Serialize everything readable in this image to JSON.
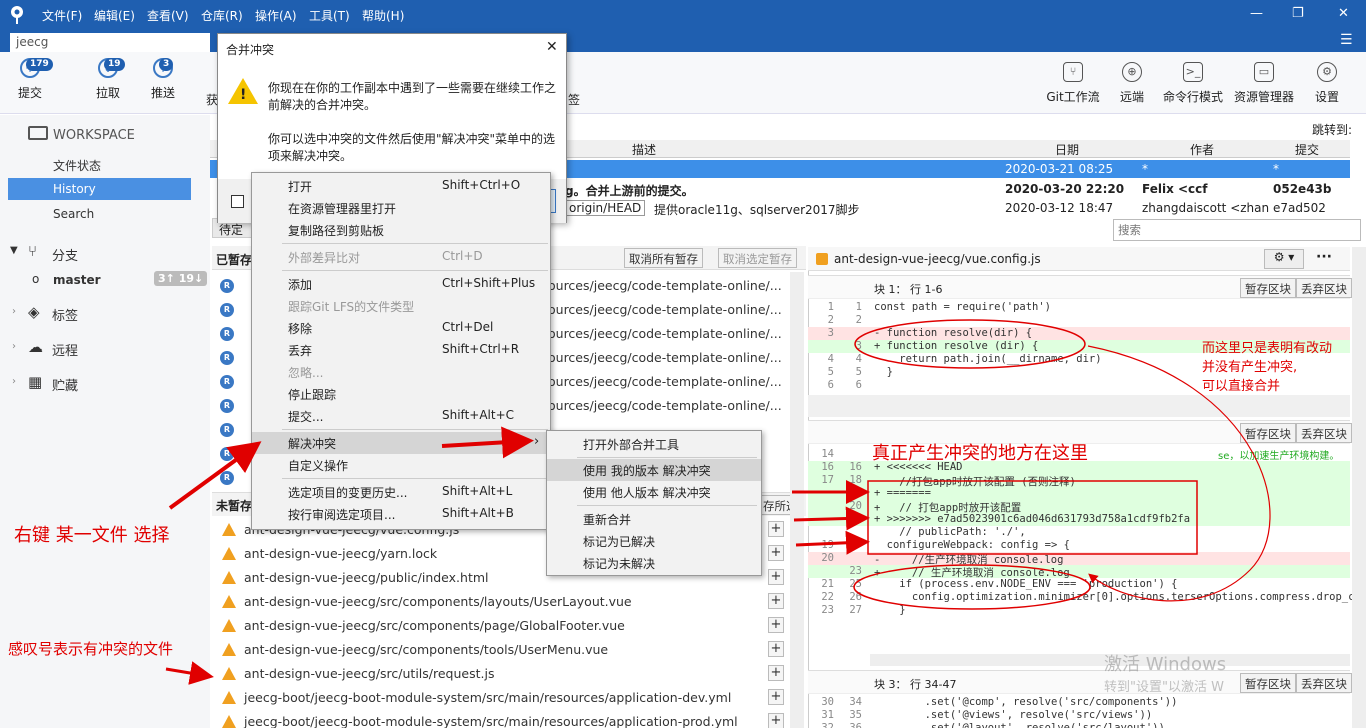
{
  "menubar": {
    "items": [
      "文件(F)",
      "编辑(E)",
      "查看(V)",
      "仓库(R)",
      "操作(A)",
      "工具(T)",
      "帮助(H)"
    ]
  },
  "tab": {
    "title": "jeecg"
  },
  "toolbar": {
    "commit": {
      "label": "提交",
      "badge": "179"
    },
    "pull": {
      "label": "拉取",
      "badge": "19"
    },
    "push": {
      "label": "推送",
      "badge": "3"
    },
    "fetch_partial": "获",
    "tag_partial": "签",
    "gitflow": "Git工作流",
    "remote": "远端",
    "terminal": "命令行模式",
    "explorer": "资源管理器",
    "settings": "设置"
  },
  "sidebar": {
    "workspace": "WORKSPACE",
    "file_status": "文件状态",
    "history": "History",
    "search": "Search",
    "branches": "分支",
    "master": "master",
    "master_badge": "3↑ 19↓",
    "tags": "标签",
    "remotes": "远程",
    "stashes": "贮藏"
  },
  "history": {
    "jump_to": "跳转到:",
    "columns": [
      "描述",
      "日期",
      "作者",
      "提交"
    ],
    "rows": [
      {
        "desc": "",
        "date": "2020-03-21 08:25",
        "author": "*",
        "commit": "*"
      },
      {
        "desc": "g。合并上游前的提交。",
        "date": "2020-03-20 22:20",
        "author": "Felix <ccf",
        "commit": "052e43b"
      },
      {
        "desc": "提供oracle11g、sqlserver2017脚步",
        "branch_tag": "origin/HEAD",
        "date": "2020-03-12 18:47",
        "author": "zhangdaiscott <zhan",
        "commit": "e7ad502"
      }
    ],
    "search_placeholder": "搜索"
  },
  "staged": {
    "title_partial": "已暂存",
    "pending_partial": "待定",
    "unstage_all": "取消所有暂存",
    "unstage_selected": "取消选定暂存",
    "files_suffix": "ources/jeecg/code-template-online/..."
  },
  "unstaged": {
    "title_partial": "未暂存",
    "stage_selected_partial": "存所选",
    "files": [
      "ant-design-vue-jeecg/vue.config.js",
      "ant-design-vue-jeecg/yarn.lock",
      "ant-design-vue-jeecg/public/index.html",
      "ant-design-vue-jeecg/src/components/layouts/UserLayout.vue",
      "ant-design-vue-jeecg/src/components/page/GlobalFooter.vue",
      "ant-design-vue-jeecg/src/components/tools/UserMenu.vue",
      "ant-design-vue-jeecg/src/utils/request.js",
      "jeecg-boot/jeecg-boot-module-system/src/main/resources/application-dev.yml",
      "jeecg-boot/jeecg-boot-module-system/src/main/resources/application-prod.yml"
    ]
  },
  "diff": {
    "file": "ant-design-vue-jeecg/vue.config.js",
    "stage_hunk": "暂存区块",
    "discard_hunk": "丢弃区块",
    "hunk1_title": "块 1： 行 1-6",
    "hunk3_title": "块 3： 行 34-47",
    "hunk1_lines": [
      {
        "o": "1",
        "n": "1",
        "t": "const path = require('path')",
        "k": ""
      },
      {
        "o": "2",
        "n": "2",
        "t": "",
        "k": ""
      },
      {
        "o": "3",
        "n": "",
        "t": "- function resolve(dir) {",
        "k": "del"
      },
      {
        "o": "",
        "n": "3",
        "t": "+ function resolve (dir) {",
        "k": "add"
      },
      {
        "o": "4",
        "n": "4",
        "t": "    return path.join(__dirname, dir)",
        "k": ""
      },
      {
        "o": "5",
        "n": "5",
        "t": "  }",
        "k": ""
      },
      {
        "o": "6",
        "n": "6",
        "t": "",
        "k": ""
      }
    ],
    "hunk2_lines": [
      {
        "o": "14",
        "n": "",
        "t": "",
        "k": ""
      },
      {
        "o": "16",
        "n": "16",
        "t": "+ <<<<<<< HEAD",
        "k": "add"
      },
      {
        "o": "17",
        "n": "18",
        "t": "    //打包app时放开该配置 (否则注释)",
        "k": "add"
      },
      {
        "o": "",
        "n": "19",
        "t": "+ =======",
        "k": "add"
      },
      {
        "o": "",
        "n": "20",
        "t": "+   // 打包app时放开该配置",
        "k": "add"
      },
      {
        "o": "",
        "n": "21",
        "t": "+ >>>>>>> e7ad5023901c6ad046d631793d758a1cdf9fb2fa",
        "k": "add"
      },
      {
        "o": "",
        "n": "",
        "t": "    // publicPath: './',",
        "k": ""
      },
      {
        "o": "19",
        "n": "",
        "t": "  configureWebpack: config => {",
        "k": ""
      },
      {
        "o": "20",
        "n": "",
        "t": "-     //生产环境取消 console.log",
        "k": "del"
      },
      {
        "o": "",
        "n": "23",
        "t": "+     // 生产环境取消 console.log",
        "k": "add"
      },
      {
        "o": "21",
        "n": "25",
        "t": "    if (process.env.NODE_ENV === 'production') {",
        "k": ""
      },
      {
        "o": "22",
        "n": "26",
        "t": "      config.optimization.minimizer[0].options.terserOptions.compress.drop_c",
        "k": ""
      },
      {
        "o": "23",
        "n": "27",
        "t": "    }",
        "k": ""
      }
    ],
    "hunk2_trailing": "se，以加速生产环境构建。",
    "hunk3_lines": [
      {
        "o": "30",
        "n": "34",
        "t": "        .set('@comp', resolve('src/components'))",
        "k": ""
      },
      {
        "o": "31",
        "n": "35",
        "t": "        .set('@views', resolve('src/views'))",
        "k": ""
      },
      {
        "o": "32",
        "n": "36",
        "t": "        .set('@layout', resolve('src/layout'))",
        "k": ""
      }
    ]
  },
  "dialog": {
    "title": "合并冲突",
    "line1": "你现在在你的工作副本中遇到了一些需要在继续工作之前解决的合并冲突。",
    "line2": "你可以选中冲突的文件然后使用\"解决冲突\"菜单中的选项来解决冲突。"
  },
  "context_menu": [
    {
      "label": "打开",
      "key": "Shift+Ctrl+O",
      "dis": false
    },
    {
      "label": "在资源管理器里打开",
      "key": "",
      "dis": false
    },
    {
      "label": "复制路径到剪贴板",
      "key": "",
      "dis": false
    },
    {
      "label": "外部差异比对",
      "key": "Ctrl+D",
      "dis": true
    },
    {
      "label": "添加",
      "key": "Ctrl+Shift+Plus",
      "dis": false
    },
    {
      "label": "跟踪Git LFS的文件类型",
      "key": "",
      "dis": true
    },
    {
      "label": "移除",
      "key": "Ctrl+Del",
      "dis": false
    },
    {
      "label": "丢弃",
      "key": "Shift+Ctrl+R",
      "dis": false
    },
    {
      "label": "忽略...",
      "key": "",
      "dis": true
    },
    {
      "label": "停止跟踪",
      "key": "",
      "dis": false
    },
    {
      "label": "提交...",
      "key": "Shift+Alt+C",
      "dis": false
    },
    {
      "label": "解决冲突",
      "key": "",
      "dis": false
    },
    {
      "label": "自定义操作",
      "key": "",
      "dis": false
    },
    {
      "label": "选定项目的变更历史...",
      "key": "Shift+Alt+L",
      "dis": false
    },
    {
      "label": "按行审阅选定项目...",
      "key": "Shift+Alt+B",
      "dis": false
    }
  ],
  "submenu": [
    "打开外部合并工具",
    "使用 我的版本 解决冲突",
    "使用 他人版本 解决冲突",
    "重新合并",
    "标记为已解决",
    "标记为未解决"
  ],
  "annotations": {
    "right_click": "右键 某一文件 选择",
    "warning_meaning": "感叹号表示有冲突的文件",
    "real_conflict": "真正产生冲突的地方在这里",
    "note1": "而这里只是表明有改动",
    "note2": "并没有产生冲突,",
    "note3": "可以直接合并"
  },
  "watermark": {
    "line1": "激活 Windows",
    "line2": "转到\"设置\"以激活 W"
  },
  "colors": {
    "accent": "#1f5fb0",
    "annotation": "#e00000",
    "warning": "#f0a020",
    "added": "#dfffdf",
    "removed": "#ffe3e3"
  }
}
